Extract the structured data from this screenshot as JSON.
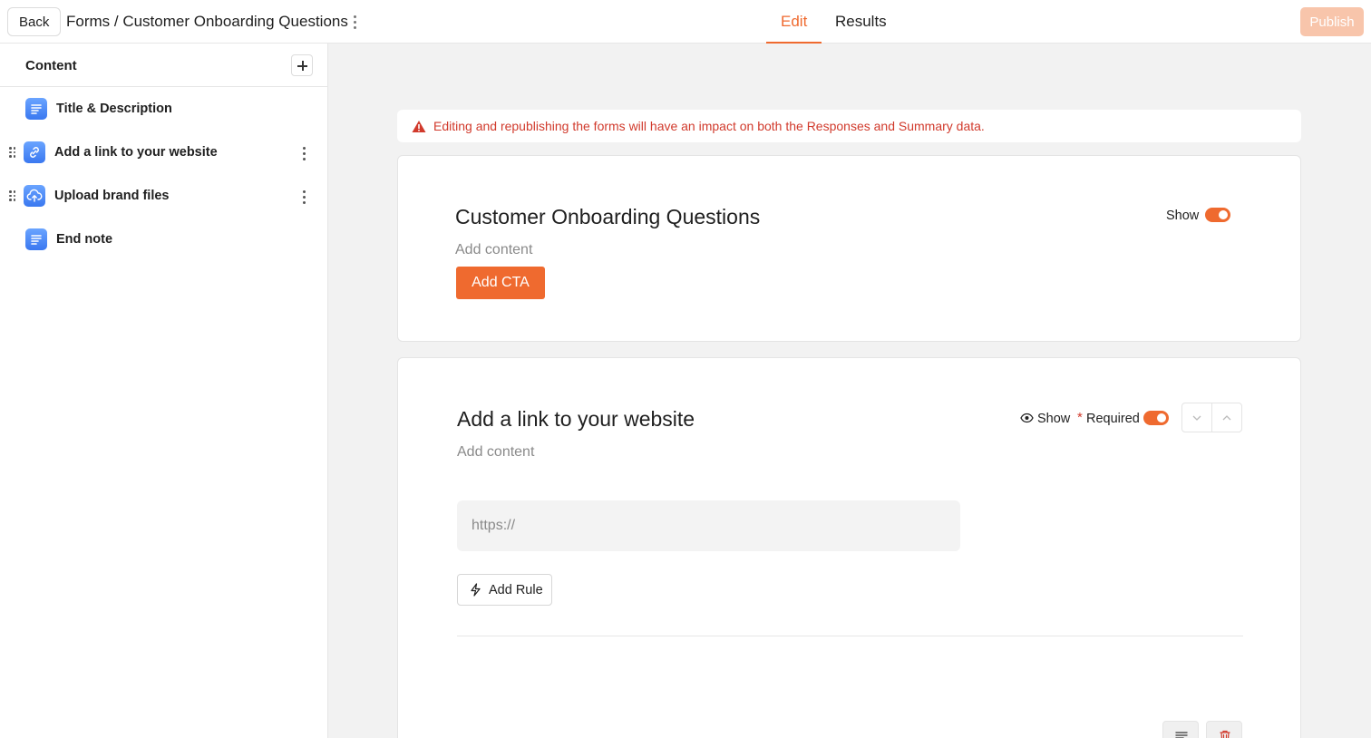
{
  "header": {
    "back_label": "Back",
    "breadcrumb": "Forms / Customer Onboarding Questions",
    "tabs": [
      {
        "label": "Edit",
        "active": true
      },
      {
        "label": "Results",
        "active": false
      }
    ],
    "publish_label": "Publish",
    "accent_color": "#ef6a2f"
  },
  "sidebar": {
    "title": "Content",
    "items": [
      {
        "label": "Title & Description",
        "icon": "text-lines-icon"
      },
      {
        "label": "Add a link to your website",
        "icon": "link-icon"
      },
      {
        "label": "Upload brand files",
        "icon": "cloud-upload-icon"
      },
      {
        "label": "End note",
        "icon": "text-lines-icon"
      }
    ]
  },
  "warning": {
    "text": "Editing and republishing the forms will have an impact on both the Responses and Summary data.",
    "color": "#d13a2c"
  },
  "title_card": {
    "title": "Customer Onboarding Questions",
    "placeholder": "Add content",
    "show_label": "Show",
    "show_enabled": true,
    "cta_label": "Add CTA"
  },
  "question_card": {
    "title": "Add a link to your website",
    "placeholder": "Add content",
    "show_label": "Show",
    "required_asterisk": "*",
    "required_label": "Required",
    "required_enabled": true,
    "input_placeholder": "https://",
    "add_rule_label": "Add Rule"
  }
}
